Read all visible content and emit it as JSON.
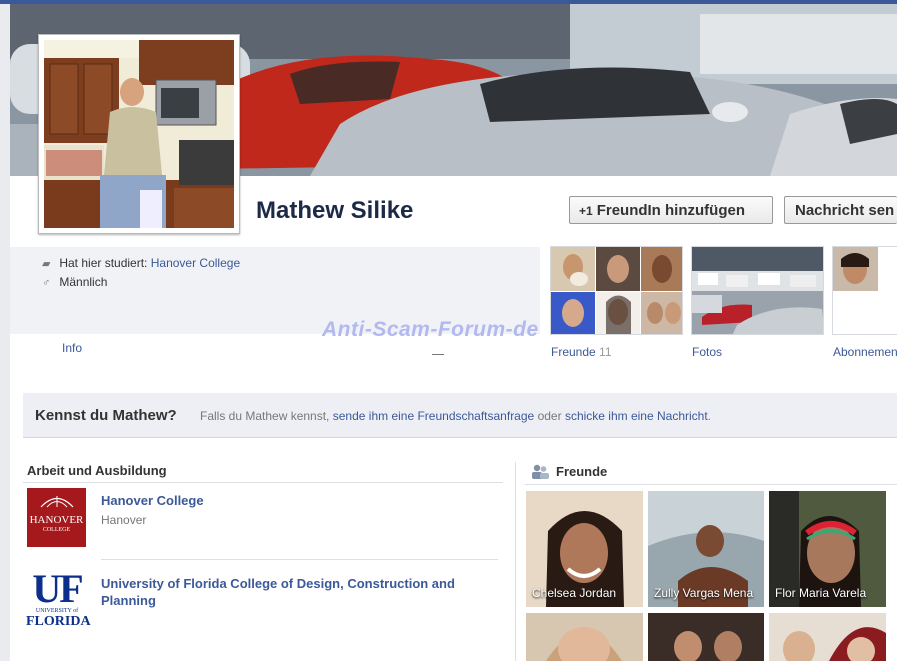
{
  "profile": {
    "name": "Mathew Silike",
    "add_friend_label": "FreundIn hinzufügen",
    "message_label": "Nachricht sen"
  },
  "info": {
    "studied_prefix": "Hat hier studiert:",
    "studied_school": "Hanover College",
    "gender": "Männlich"
  },
  "tabs": {
    "info": "Info",
    "friends": "Freunde",
    "friends_count": "11",
    "photos": "Fotos",
    "subscriptions": "Abonnemen"
  },
  "watermark": "Anti-Scam-Forum-de",
  "kennst": {
    "title": "Kennst du Mathew?",
    "text_prefix": "Falls du Mathew kennst,",
    "link1": "sende ihm eine Freundschaftsanfrage",
    "text_mid": "oder",
    "link2": "schicke ihm eine Nachricht",
    "text_end": "."
  },
  "work_edu": {
    "title": "Arbeit und Ausbildung",
    "items": [
      {
        "name": "Hanover College",
        "sub": "Hanover",
        "logo_text": "HANOVER",
        "logo_sub": "COLLEGE"
      },
      {
        "name": "University of Florida College of Design, Construction and Planning",
        "sub": "",
        "logo_text": "UF",
        "logo_sub1": "UNIVERSITY of",
        "logo_sub2": "FLORIDA"
      }
    ]
  },
  "friends": {
    "title": "Freunde",
    "tiles": [
      {
        "name": "Chelsea Jordan"
      },
      {
        "name": "Zully Vargas Mena"
      },
      {
        "name": "Flor Maria Varela"
      }
    ]
  },
  "colors": {
    "brand_blue": "#3b5998",
    "hanover_red": "#a5181c",
    "uf_blue": "#0b2f8a"
  }
}
